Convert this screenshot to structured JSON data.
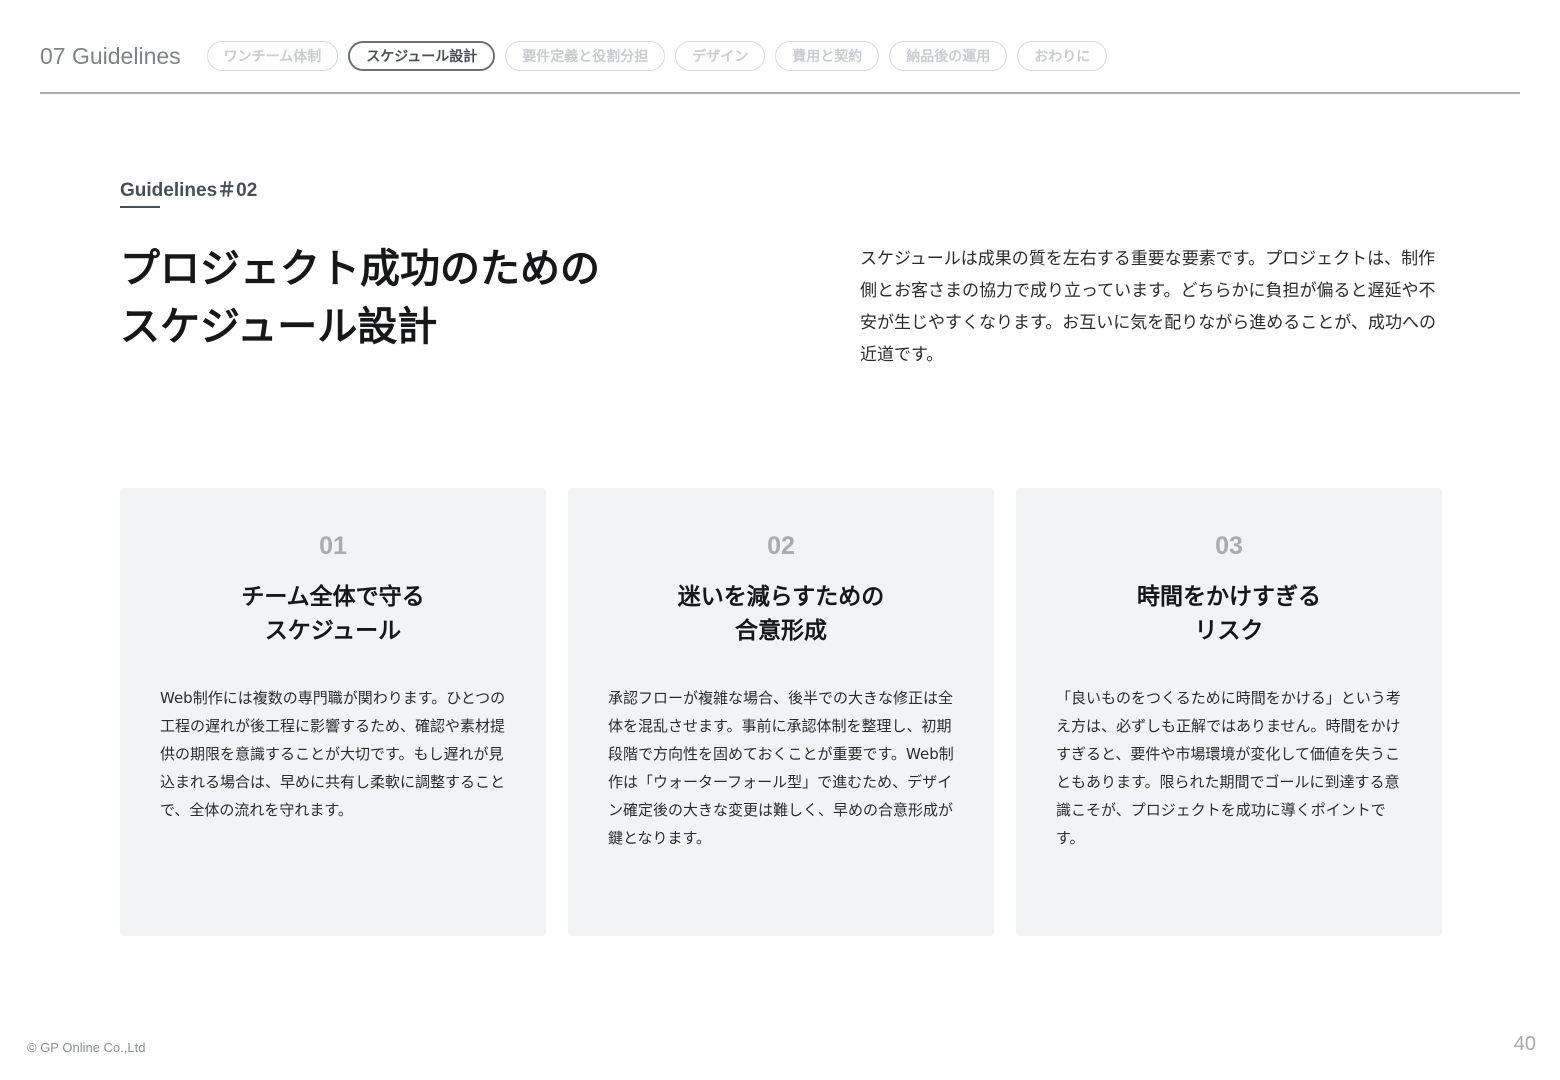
{
  "header": {
    "section_title": "07 Guidelines",
    "tabs": [
      {
        "label": "ワンチーム体制",
        "active": false
      },
      {
        "label": "スケジュール設計",
        "active": true
      },
      {
        "label": "要件定義と役割分担",
        "active": false
      },
      {
        "label": "デザイン",
        "active": false
      },
      {
        "label": "費用と契約",
        "active": false
      },
      {
        "label": "納品後の運用",
        "active": false
      },
      {
        "label": "おわりに",
        "active": false
      }
    ]
  },
  "main": {
    "eyebrow": "Guidelines＃02",
    "headline_line1": "プロジェクト成功のための",
    "headline_line2": "スケジュール設計",
    "intro": "スケジュールは成果の質を左右する重要な要素です。プロジェクトは、制作側とお客さまの協力で成り立っています。どちらかに負担が偏ると遅延や不安が生じやすくなります。お互いに気を配りながら進めることが、成功への近道です。"
  },
  "cards": [
    {
      "number": "01",
      "title_line1": "チーム全体で守る",
      "title_line2": "スケジュール",
      "body": "Web制作には複数の専門職が関わります。ひとつの工程の遅れが後工程に影響するため、確認や素材提供の期限を意識することが大切です。もし遅れが見込まれる場合は、早めに共有し柔軟に調整することで、全体の流れを守れます。"
    },
    {
      "number": "02",
      "title_line1": "迷いを減らすための",
      "title_line2": "合意形成",
      "body": "承認フローが複雑な場合、後半での大きな修正は全体を混乱させます。事前に承認体制を整理し、初期段階で方向性を固めておくことが重要です。Web制作は「ウォーターフォール型」で進むため、デザイン確定後の大きな変更は難しく、早めの合意形成が鍵となります。"
    },
    {
      "number": "03",
      "title_line1": "時間をかけすぎる",
      "title_line2": "リスク",
      "body": "「良いものをつくるために時間をかける」という考え方は、必ずしも正解ではありません。時間をかけすぎると、要件や市場環境が変化して価値を失うこともあります。限られた期間でゴールに到達する意識こそが、プロジェクトを成功に導くポイントです。"
    }
  ],
  "footer": {
    "copyright": "© GP Online Co.,Ltd",
    "page_number": "40"
  }
}
